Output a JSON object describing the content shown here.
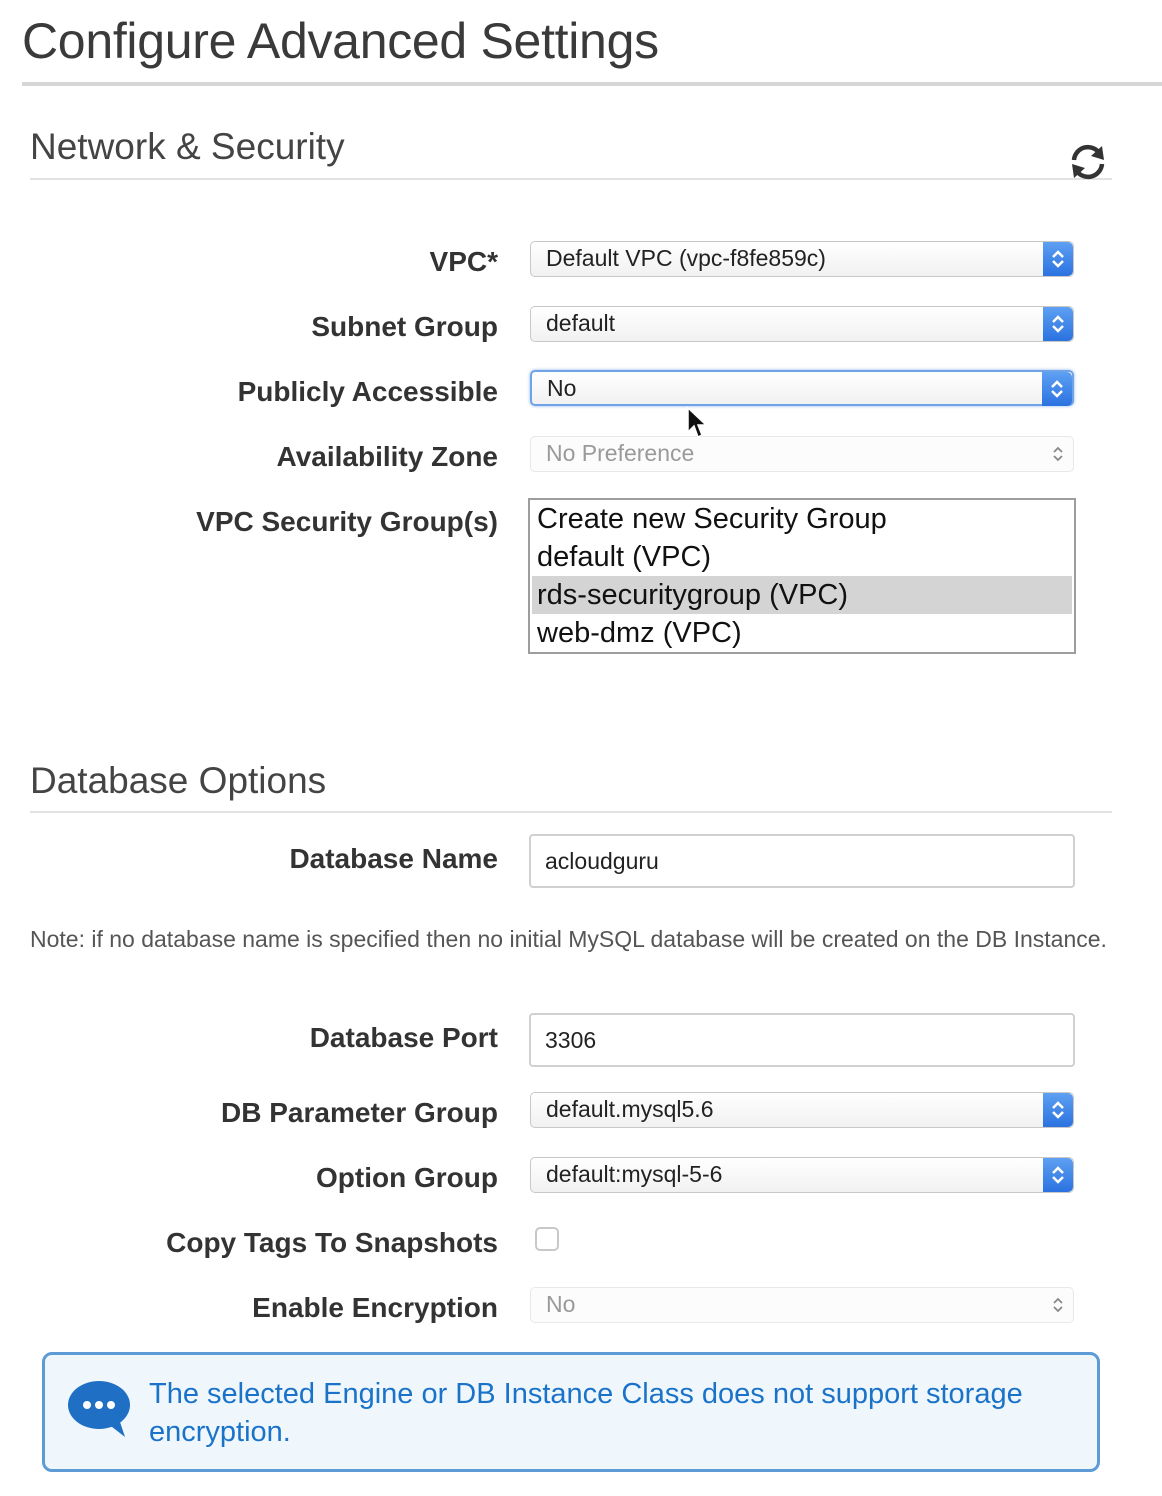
{
  "page": {
    "title": "Configure Advanced Settings"
  },
  "network": {
    "title": "Network & Security",
    "refresh_icon": "refresh-icon",
    "fields": {
      "vpc": {
        "label": "VPC*",
        "value": "Default VPC (vpc-f8fe859c)"
      },
      "subnet_group": {
        "label": "Subnet Group",
        "value": "default"
      },
      "publicly_accessible": {
        "label": "Publicly Accessible",
        "value": "No"
      },
      "availability_zone": {
        "label": "Availability Zone",
        "value": "No Preference"
      },
      "security_groups": {
        "label": "VPC Security Group(s)",
        "options": [
          "Create new Security Group",
          "default (VPC)",
          "rds-securitygroup (VPC)",
          "web-dmz (VPC)"
        ],
        "selected": "rds-securitygroup (VPC)"
      }
    }
  },
  "database": {
    "title": "Database Options",
    "fields": {
      "name": {
        "label": "Database Name",
        "value": "acloudguru"
      },
      "note": "Note: if no database name is specified then no initial MySQL database will be created on the DB Instance.",
      "port": {
        "label": "Database Port",
        "value": "3306"
      },
      "parameter_group": {
        "label": "DB Parameter Group",
        "value": "default.mysql5.6"
      },
      "option_group": {
        "label": "Option Group",
        "value": "default:mysql-5-6"
      },
      "copy_tags": {
        "label": "Copy Tags To Snapshots",
        "checked": false
      },
      "encryption": {
        "label": "Enable Encryption",
        "value": "No"
      }
    },
    "info_message": "The selected Engine or DB Instance Class does not support storage encryption.",
    "info_icon": "chat-bubble-icon"
  },
  "colors": {
    "accent": "#2b72e0",
    "info_border": "#5c9bd6",
    "info_text": "#1a73c8"
  }
}
